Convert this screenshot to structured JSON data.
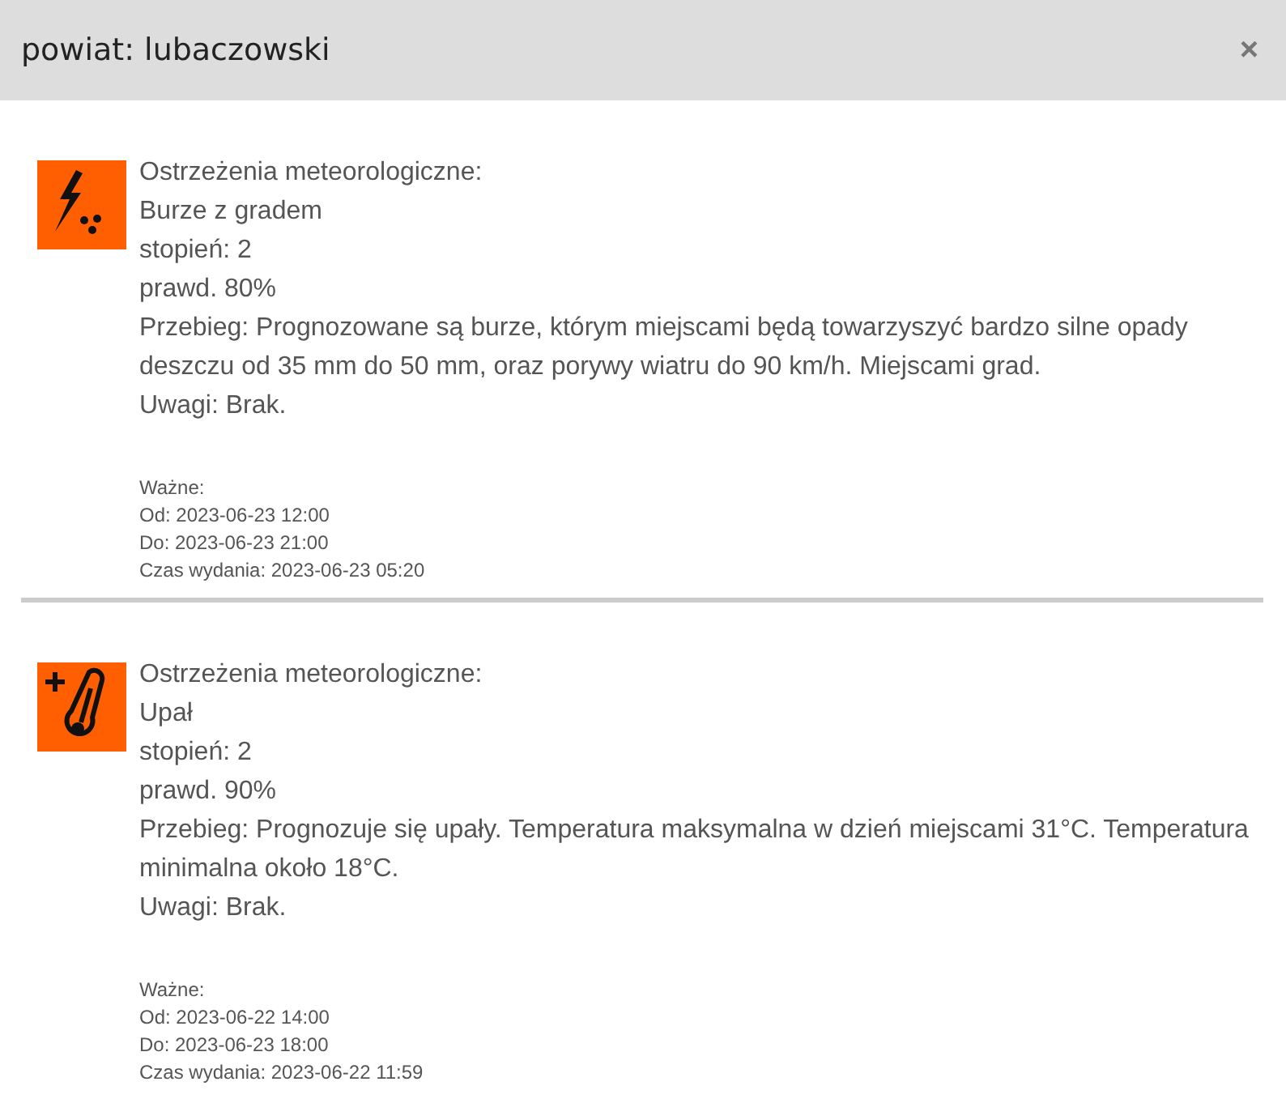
{
  "dialog": {
    "title": "powiat: lubaczowski",
    "close": "×"
  },
  "warnings": [
    {
      "kind": "storm-hail",
      "heading": "Ostrzeżenia meteorologiczne:",
      "name": "Burze z gradem",
      "degree": "stopień: 2",
      "probability": "prawd. 80%",
      "course": "Przebieg: Prognozowane są burze, którym miejscami będą towarzyszyć bardzo silne opady deszczu od 35 mm do 50 mm, oraz porywy wiatru do 90 km/h. Miejscami grad.",
      "remarks": "Uwagi: Brak.",
      "valid_label": "Ważne:",
      "from": "Od: 2023-06-23 12:00",
      "to": "Do: 2023-06-23 21:00",
      "issued": "Czas wydania: 2023-06-23 05:20"
    },
    {
      "kind": "heat",
      "heading": "Ostrzeżenia meteorologiczne:",
      "name": "Upał",
      "degree": "stopień: 2",
      "probability": "prawd. 90%",
      "course": "Przebieg: Prognozuje się upały. Temperatura maksymalna w dzień miejscami 31°C. Temperatura minimalna około 18°C.",
      "remarks": "Uwagi: Brak.",
      "valid_label": "Ważne:",
      "from": "Od: 2023-06-22 14:00",
      "to": "Do: 2023-06-23 18:00",
      "issued": "Czas wydania: 2023-06-22 11:59"
    }
  ]
}
